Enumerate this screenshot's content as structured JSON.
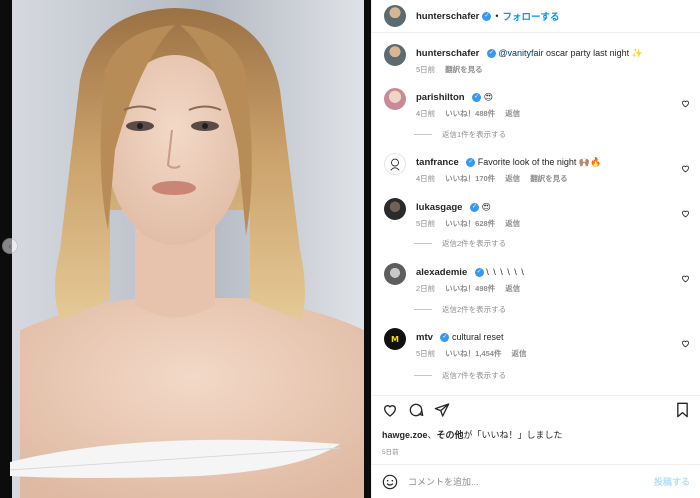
{
  "post": {
    "author": "hunterschafer",
    "follow_label": "フォローする",
    "separator": "•"
  },
  "caption": {
    "username": "hunterschafer",
    "mention": "@vanityfair",
    "text": " oscar party last night",
    "emoji": "✨",
    "time": "5日前",
    "translate": "翻訳を見る"
  },
  "comments": [
    {
      "username": "parishilton",
      "text": "",
      "emoji": "😍",
      "time": "4日前",
      "likes": "いいね！488件",
      "reply": "返信",
      "translate": "",
      "replies_label": "返信1件を表示する"
    },
    {
      "username": "tanfrance",
      "text": "Favorite look of the night",
      "emoji": "🙌🏽🔥",
      "time": "4日前",
      "likes": "いいね！170件",
      "reply": "返信",
      "translate": "翻訳を見る",
      "replies_label": ""
    },
    {
      "username": "lukasgage",
      "text": "",
      "emoji": "😍",
      "time": "5日前",
      "likes": "いいね！628件",
      "reply": "返信",
      "translate": "",
      "replies_label": "返信2件を表示する"
    },
    {
      "username": "alexademie",
      "text": "\\ \\ \\ \\ \\ \\",
      "emoji": "",
      "time": "2日前",
      "likes": "いいね！498件",
      "reply": "返信",
      "translate": "",
      "replies_label": "返信2件を表示する"
    },
    {
      "username": "mtv",
      "text": "cultural reset",
      "emoji": "",
      "time": "5日前",
      "likes": "いいね！1,454件",
      "reply": "返信",
      "translate": "",
      "replies_label": "返信7件を表示する"
    }
  ],
  "mtv_logo": "M",
  "likes_line": {
    "user": "hawge.zoe",
    "middle": "、",
    "others": "その他",
    "suffix": "が「いいね！」しました"
  },
  "posted_time": "5日前",
  "composer": {
    "placeholder": "コメントを追加...",
    "post_label": "投稿する"
  },
  "icons": [
    "heart-icon",
    "comment-icon",
    "share-icon",
    "bookmark-icon",
    "emoji-icon",
    "verified-icon",
    "carousel-prev-icon"
  ],
  "colors": {
    "accent": "#0095f6",
    "verified": "#3897f0",
    "muted": "#8e8e8e",
    "post_disabled": "#b2dffc"
  }
}
